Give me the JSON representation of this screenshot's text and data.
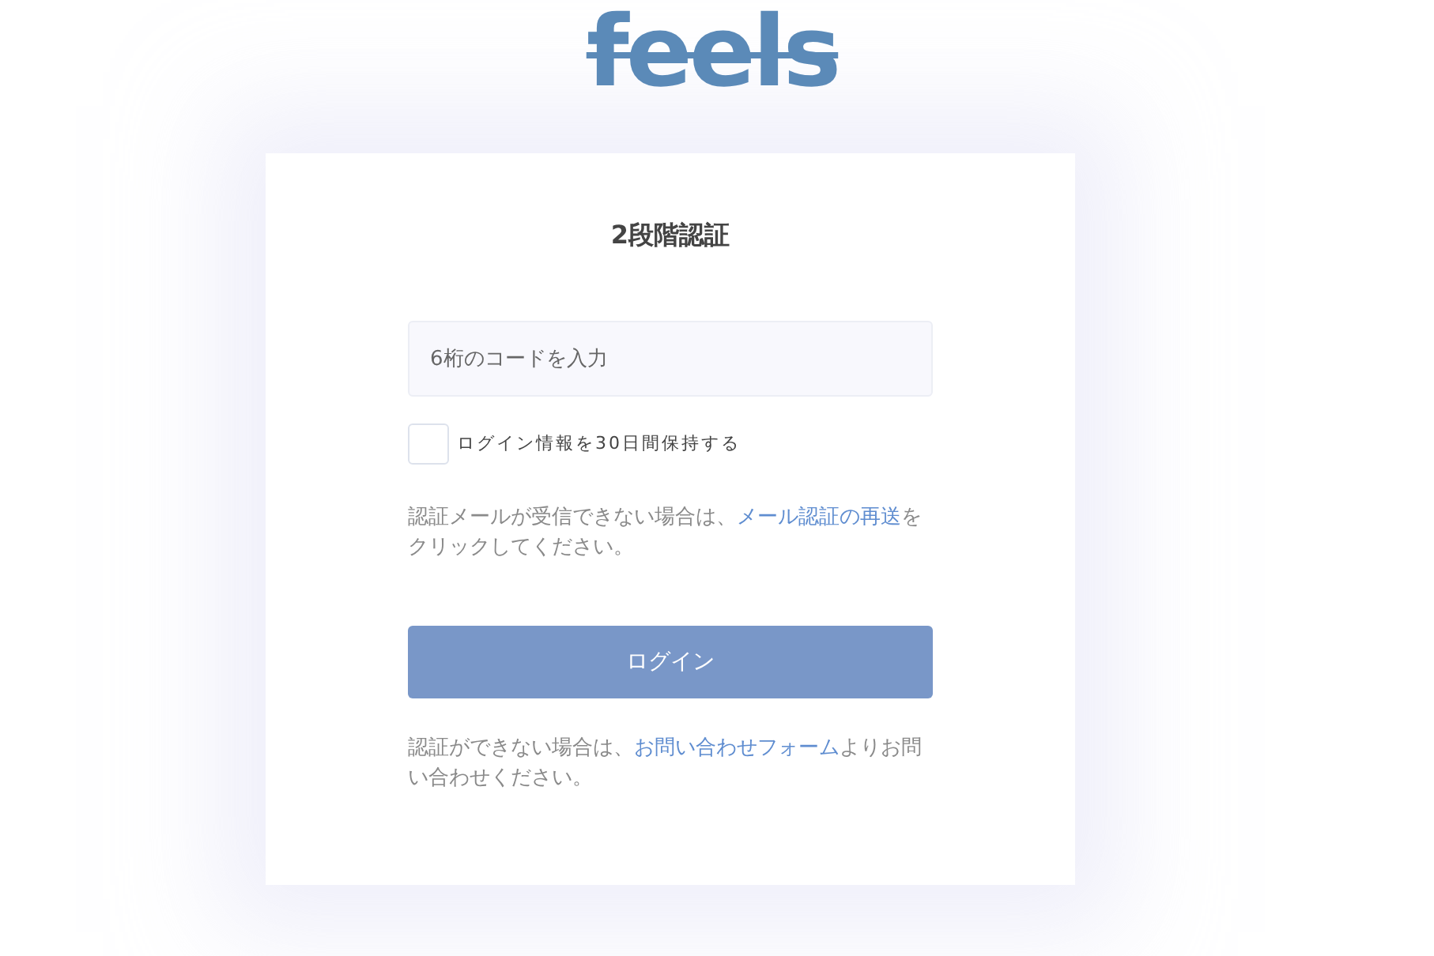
{
  "logo": "feels",
  "card": {
    "title": "2段階認証",
    "code_field": {
      "placeholder": "6桁のコードを入力"
    },
    "remember": {
      "label": "ログイン情報を30日間保持する",
      "checked": false
    },
    "resend_notice": {
      "before": "認証メールが受信できない場合は、",
      "link": "メール認証の再送",
      "after": "をクリックしてください。"
    },
    "login_button": "ログイン",
    "contact_notice": {
      "before": "認証ができない場合は、",
      "link": "お問い合わせフォーム",
      "after": "よりお問い合わせください。"
    }
  }
}
